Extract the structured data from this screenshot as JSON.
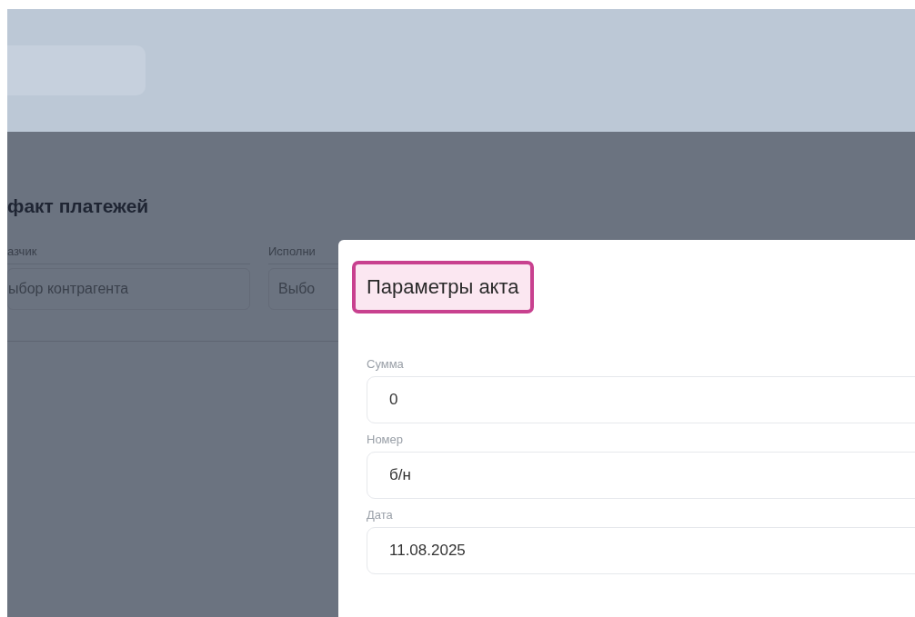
{
  "page": {
    "title": "факт платежей",
    "filters": [
      {
        "label": "азчик",
        "placeholder": "ыбор контрагента"
      },
      {
        "label": "Исполни",
        "placeholder": "Выбо"
      }
    ]
  },
  "modal": {
    "title": "Параметры акта",
    "title_highlighted": true,
    "fields": [
      {
        "label": "Сумма",
        "value": "0"
      },
      {
        "label": "Номер",
        "value": "б/н"
      },
      {
        "label": "Дата",
        "value": "11.08.2025"
      }
    ]
  }
}
